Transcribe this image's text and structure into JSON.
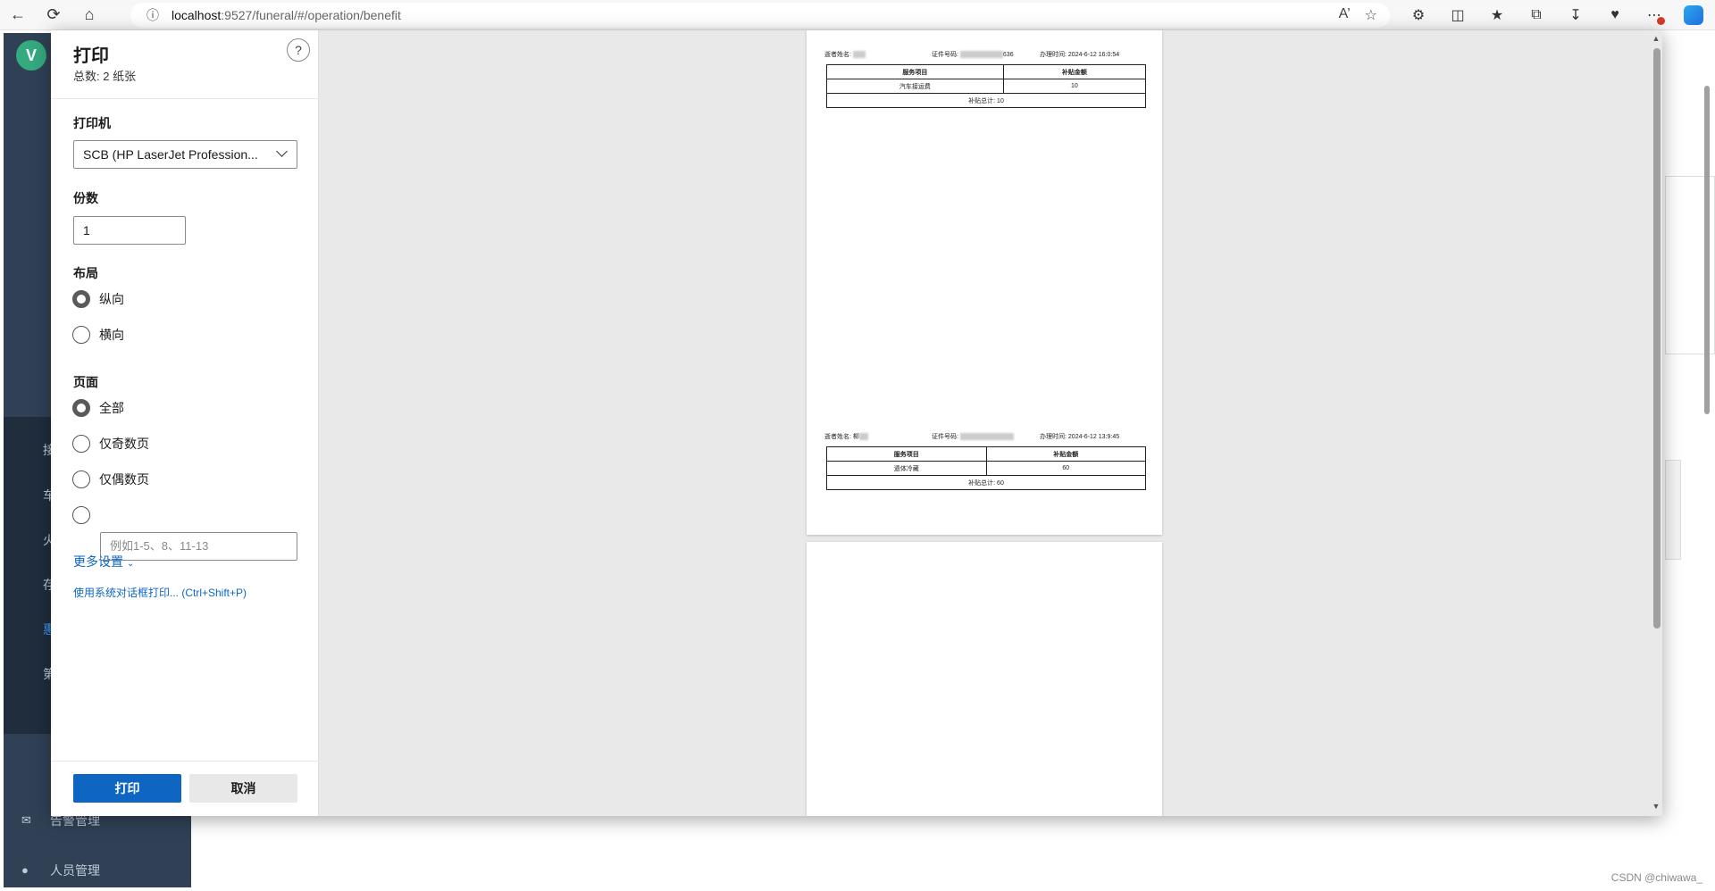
{
  "browser": {
    "url_host": "localhost",
    "url_path": ":9527/funeral/#/operation/benefit"
  },
  "app": {
    "sidebar": {
      "logo_letter": "V",
      "items": [
        {
          "label": "告警管理"
        },
        {
          "label": "人员管理"
        }
      ],
      "submenu": [
        "接",
        "车",
        "火",
        "存",
        "惠",
        "第"
      ]
    },
    "watermark": "CSDN @chiwawa_"
  },
  "print_dialog": {
    "title": "打印",
    "subtitle": "总数: 2 纸张",
    "help": "?",
    "printer_label": "打印机",
    "printer_value": "SCB (HP LaserJet Profession...",
    "copies_label": "份数",
    "copies_value": "1",
    "layout_label": "布局",
    "layout_options": [
      {
        "label": "纵向",
        "selected": true
      },
      {
        "label": "横向",
        "selected": false
      }
    ],
    "pages_label": "页面",
    "pages_options": [
      {
        "label": "全部",
        "selected": true
      },
      {
        "label": "仅奇数页",
        "selected": false
      },
      {
        "label": "仅偶数页",
        "selected": false
      }
    ],
    "range_placeholder": "例如1-5、8、11-13",
    "more_settings": "更多设置",
    "system_dialog_link": "使用系统对话框打印... (Ctrl+Shift+P)",
    "print_button": "打印",
    "cancel_button": "取消"
  },
  "preview": {
    "records": [
      {
        "name_label": "逝者姓名:",
        "id_label": "证件号码:",
        "id_suffix": "636",
        "time_label": "办理时间:",
        "time_value": "2024-6-12 16:0:54",
        "col1": "服务项目",
        "col2": "补贴金额",
        "item": "汽车接运费",
        "amount": "10",
        "total": "补贴总计: 10"
      },
      {
        "name_label": "逝者姓名:",
        "name_partial": "柳",
        "id_label": "证件号码:",
        "id_suffix": "",
        "time_label": "办理时间:",
        "time_value": "2024-6-12 13:9:45",
        "col1": "服务项目",
        "col2": "补贴金额",
        "item": "遗体冷藏",
        "amount": "60",
        "total": "补贴总计: 60"
      }
    ]
  }
}
